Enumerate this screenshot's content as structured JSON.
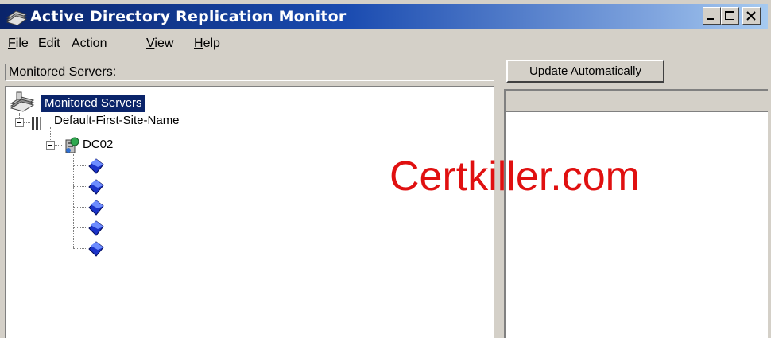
{
  "window": {
    "title": "Active Directory Replication Monitor",
    "title_icon": "adrepl-monitor-icon",
    "controls": [
      "minimize-icon",
      "maximize-icon",
      "close-icon"
    ]
  },
  "menu": {
    "file": {
      "acc": "F",
      "rest": "ile"
    },
    "edit": {
      "acc": "",
      "rest": "Edit"
    },
    "action": {
      "acc": "",
      "rest": "Action"
    },
    "view": {
      "acc": "V",
      "rest": "iew"
    },
    "help": {
      "acc": "H",
      "rest": "elp"
    }
  },
  "left": {
    "header": "Monitored Servers:",
    "tree": {
      "root": {
        "label": "Monitored Servers",
        "icon": "servers-icon",
        "selected": true
      },
      "site": {
        "label": "Default-First-Site-Name",
        "icon": "site-icon",
        "expanded": true
      },
      "server": {
        "label": "DC02",
        "icon": "server-icon",
        "expanded": true
      },
      "partitions": [
        {
          "icon": "partition-book-icon"
        },
        {
          "icon": "partition-book-icon"
        },
        {
          "icon": "partition-book-icon"
        },
        {
          "icon": "partition-book-icon"
        },
        {
          "icon": "partition-book-icon"
        }
      ]
    }
  },
  "right": {
    "update_button": "Update Automatically"
  },
  "watermark": {
    "text": "Certkiller.com",
    "color": "#e01010"
  },
  "colors": {
    "titlebar_start": "#0a246a",
    "titlebar_end": "#a6caf0",
    "face": "#d4d0c8",
    "selection": "#0a246a"
  }
}
